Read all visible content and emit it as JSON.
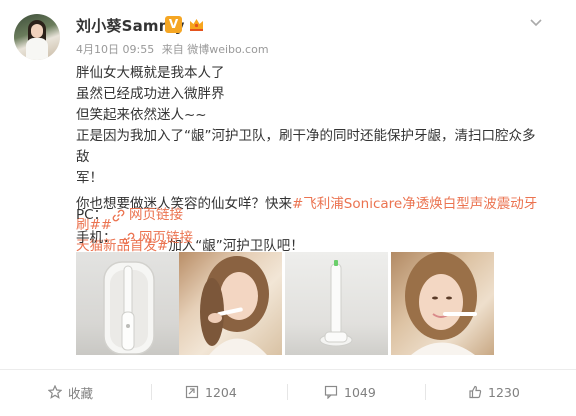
{
  "post": {
    "user_name": "刘小葵Sammy",
    "verified_mark": "V",
    "timestamp": "4月10日 09:55",
    "source": "来自 微博weibo.com",
    "lines": [
      "胖仙女大概就是我本人了",
      "虽然已经成功进入微胖界",
      "但笑起来依然迷人~~",
      "正是因为我加入了“龈”河护卫队，刷干净的同时还能保护牙龈，清扫口腔众多敌",
      "军！"
    ],
    "line6_prefix": "你也想要做迷人笑容的仙女咩？快来",
    "topic_1_part_a": "#飞利浦Sonicare净透焕白型声波震动牙刷##",
    "topic_1_part_b": "天猫新品首发#",
    "line7_suffix": "加入“龈”河护卫队吧！",
    "pc_label": "PC：",
    "pc_link": "网页链接",
    "mobile_label": "手机：",
    "mobile_link": "网页链接"
  },
  "actions": {
    "favorite_label": "收藏",
    "repost_count": "1204",
    "comment_count": "1049",
    "like_count": "1230"
  },
  "colors": {
    "accent": "#eb7350",
    "verified": "#f5a623",
    "muted": "#999999"
  }
}
